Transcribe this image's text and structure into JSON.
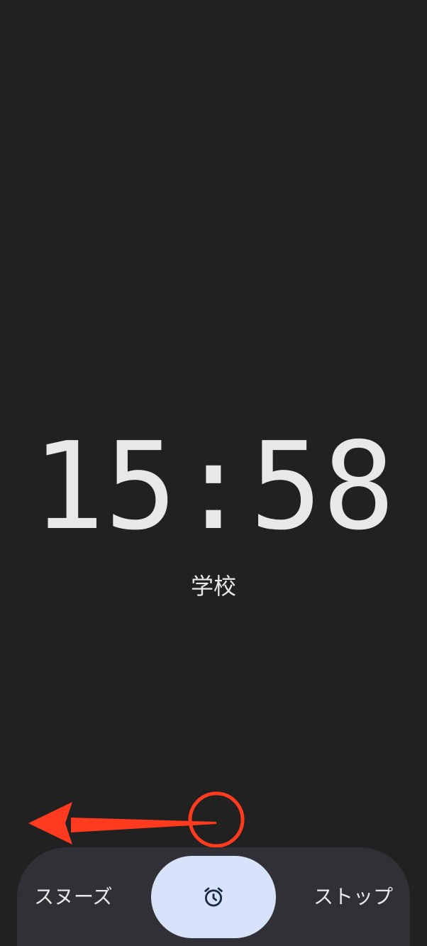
{
  "alarm": {
    "time": "15:58",
    "label": "学校"
  },
  "actions": {
    "snooze_label": "スヌーズ",
    "stop_label": "ストップ",
    "handle_icon": "alarm-clock-icon"
  },
  "colors": {
    "background": "#212121",
    "text": "#e8e8e8",
    "bar": "#303036",
    "handle": "#d6e3fb",
    "handle_icon": "#1b2a44",
    "annotation": "#ff3b1f"
  }
}
